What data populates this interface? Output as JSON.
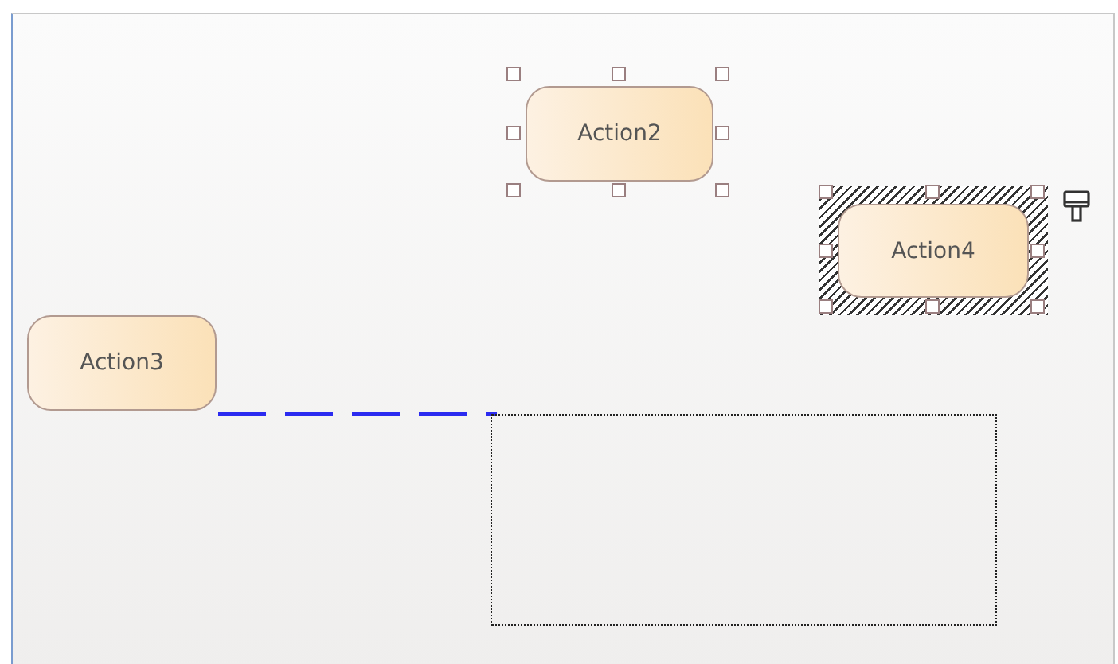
{
  "nodes": [
    {
      "label": "Action2",
      "selected": true,
      "focused": false
    },
    {
      "label": "Action4",
      "selected": true,
      "focused": true
    },
    {
      "label": "Action3",
      "selected": false,
      "focused": false
    }
  ],
  "rubber_band": {
    "visible": true
  }
}
